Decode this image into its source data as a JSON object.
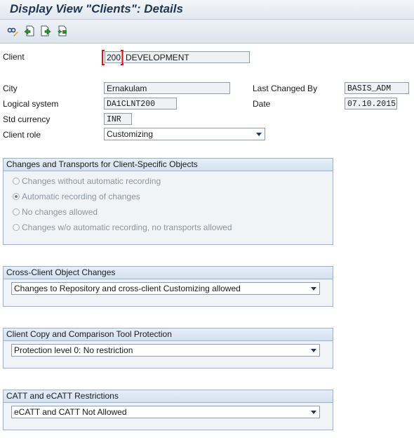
{
  "title": "Display View \"Clients\": Details",
  "toolbar": {
    "icons": [
      "display-change-icon",
      "previous-entry-icon",
      "next-entry-icon",
      "other-entry-icon"
    ]
  },
  "fields": {
    "client_label": "Client",
    "client_value": "200",
    "client_name": "DEVELOPMENT",
    "city_label": "City",
    "city_value": "Ernakulam",
    "logical_label": "Logical system",
    "logical_value": "DA1CLNT200",
    "currency_label": "Std currency",
    "currency_value": "INR",
    "role_label": "Client role",
    "role_value": "Customizing",
    "changed_by_label": "Last Changed By",
    "changed_by_value": "BASIS_ADM",
    "date_label": "Date",
    "date_value": "07.10.2015"
  },
  "groups": {
    "transports": {
      "title": "Changes and Transports for Client-Specific Objects",
      "options": [
        "Changes without automatic recording",
        "Automatic recording of changes",
        "No changes allowed",
        "Changes w/o automatic recording, no transports allowed"
      ],
      "selected_index": 1
    },
    "cross_client": {
      "title": "Cross-Client Object Changes",
      "value": "Changes to Repository and cross-client Customizing allowed"
    },
    "copy_protection": {
      "title": "Client Copy and Comparison Tool Protection",
      "value": "Protection level 0: No restriction"
    },
    "catt": {
      "title": "CATT and eCATT Restrictions",
      "value": "eCATT and CATT Not Allowed"
    }
  }
}
